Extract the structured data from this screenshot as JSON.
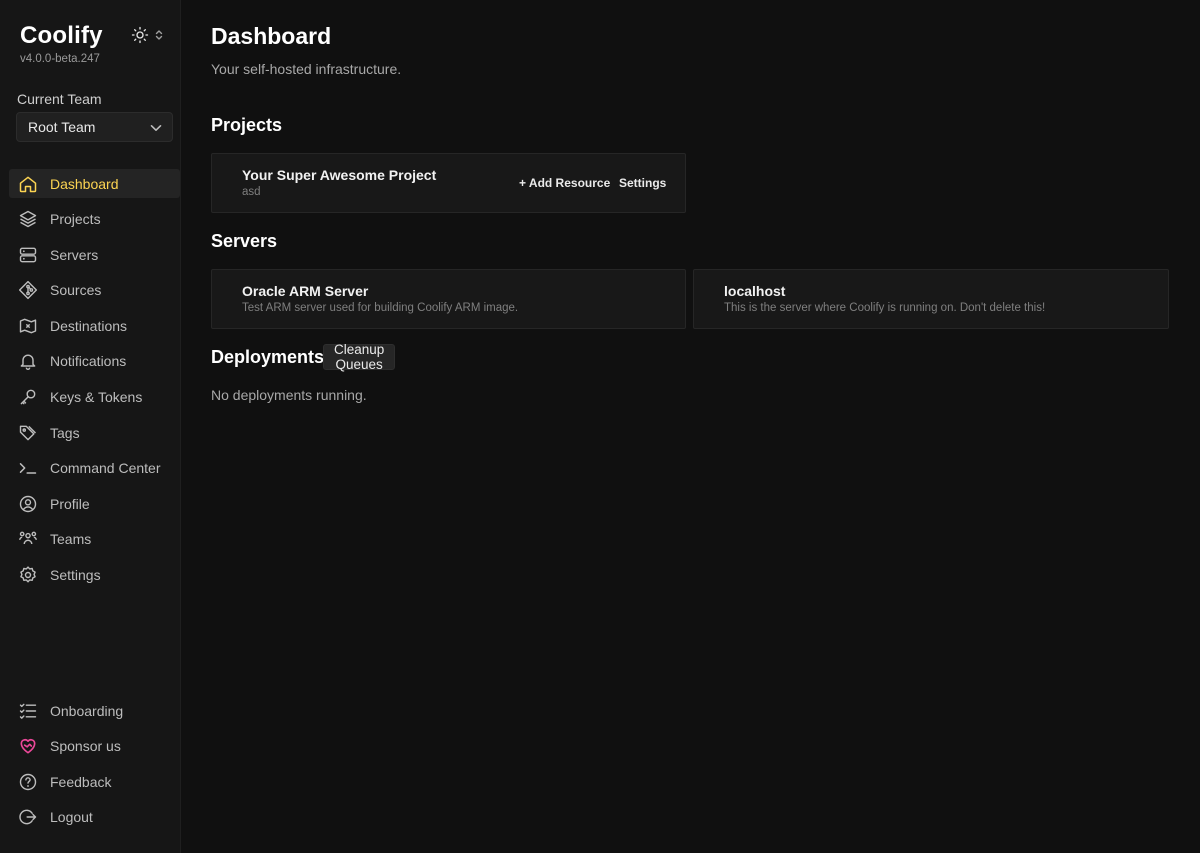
{
  "app": {
    "name": "Coolify",
    "version": "v4.0.0-beta.247"
  },
  "team": {
    "label": "Current Team",
    "selected": "Root Team"
  },
  "colors": {
    "accent": "#fcd452",
    "sponsor": "#ec4899"
  },
  "nav": {
    "items": [
      {
        "label": "Dashboard",
        "icon": "home-icon",
        "active": true
      },
      {
        "label": "Projects",
        "icon": "layers-icon"
      },
      {
        "label": "Servers",
        "icon": "server-icon"
      },
      {
        "label": "Sources",
        "icon": "git-icon"
      },
      {
        "label": "Destinations",
        "icon": "destination-icon"
      },
      {
        "label": "Notifications",
        "icon": "bell-icon"
      },
      {
        "label": "Keys & Tokens",
        "icon": "key-icon"
      },
      {
        "label": "Tags",
        "icon": "tag-icon"
      },
      {
        "label": "Command Center",
        "icon": "terminal-icon"
      },
      {
        "label": "Profile",
        "icon": "user-circle-icon"
      },
      {
        "label": "Teams",
        "icon": "users-icon"
      },
      {
        "label": "Settings",
        "icon": "gear-icon"
      }
    ],
    "bottom": [
      {
        "label": "Onboarding",
        "icon": "checklist-icon"
      },
      {
        "label": "Sponsor us",
        "icon": "heart-icon"
      },
      {
        "label": "Feedback",
        "icon": "question-icon"
      },
      {
        "label": "Logout",
        "icon": "logout-icon"
      }
    ]
  },
  "page": {
    "title": "Dashboard",
    "subtitle": "Your self-hosted infrastructure."
  },
  "projects": {
    "heading": "Projects",
    "items": [
      {
        "name": "Your Super Awesome Project",
        "description": "asd",
        "add_resource": "+ Add Resource",
        "settings": "Settings"
      }
    ]
  },
  "servers": {
    "heading": "Servers",
    "items": [
      {
        "name": "Oracle ARM Server",
        "description": "Test ARM server used for building Coolify ARM image."
      },
      {
        "name": "localhost",
        "description": "This is the server where Coolify is running on. Don't delete this!"
      }
    ]
  },
  "deployments": {
    "heading": "Deployments",
    "cleanup_label": "Cleanup Queues",
    "empty_text": "No deployments running."
  }
}
